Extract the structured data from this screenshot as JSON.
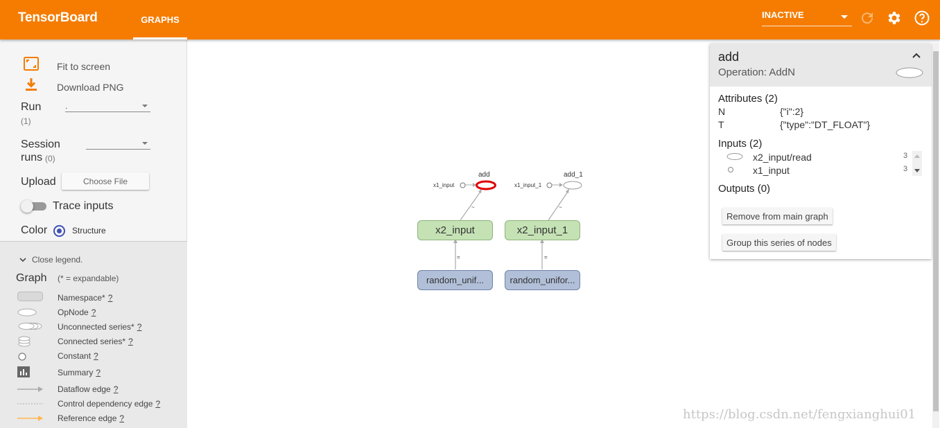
{
  "header": {
    "brand": "TensorBoard",
    "tab": "GRAPHS",
    "run_select": "INACTIVE",
    "icons": [
      "refresh-icon",
      "settings-icon",
      "help-icon"
    ],
    "accent_color": "#f57c00"
  },
  "sidebar": {
    "fit_label": "Fit to screen",
    "download_label": "Download PNG",
    "run_label": "Run",
    "run_count": "(1)",
    "run_value": ".",
    "session_label_1": "Session",
    "session_label_2": "runs",
    "session_count": "(0)",
    "upload_label": "Upload",
    "choose_file": "Choose File",
    "trace_label": "Trace inputs",
    "color_label": "Color",
    "color_option": "Structure"
  },
  "legend": {
    "close": "Close legend.",
    "title": "Graph",
    "subtitle": "(* = expandable)",
    "items": [
      {
        "label": "Namespace*",
        "q": "?"
      },
      {
        "label": "OpNode",
        "q": "?"
      },
      {
        "label": "Unconnected series*",
        "q": "?"
      },
      {
        "label": "Connected series*",
        "q": "?"
      },
      {
        "label": "Constant",
        "q": "?"
      },
      {
        "label": "Summary",
        "q": "?"
      },
      {
        "label": "Dataflow edge",
        "q": "?"
      },
      {
        "label": "Control dependency edge",
        "q": "?"
      },
      {
        "label": "Reference edge",
        "q": "?"
      }
    ]
  },
  "graph": {
    "nodes": {
      "add": "add",
      "add_1": "add_1",
      "x1_input": "x1_input",
      "x1_input_1": "x1_input_1",
      "x2_input": "x2_input",
      "x2_input_1": "x2_input_1",
      "random_a": "random_unif...",
      "random_b": "random_unifor..."
    },
    "edge_marks": {
      "small_1": "~",
      "small_2": "~",
      "small_3": "=",
      "small_4": "="
    },
    "selected_color": "#e00000"
  },
  "info_card": {
    "title": "add",
    "operation": "Operation: AddN",
    "attributes_header": "Attributes (2)",
    "attributes": [
      {
        "key": "N",
        "value": "{\"i\":2}"
      },
      {
        "key": "T",
        "value": "{\"type\":\"DT_FLOAT\"}"
      }
    ],
    "inputs_header": "Inputs (2)",
    "inputs": [
      {
        "name": "x2_input/read",
        "count": "3"
      },
      {
        "name": "x1_input",
        "count": "3"
      }
    ],
    "outputs_header": "Outputs (0)",
    "remove_button": "Remove from main graph",
    "group_button": "Group this series of nodes"
  },
  "watermark": "https://blog.csdn.net/fengxianghui01"
}
